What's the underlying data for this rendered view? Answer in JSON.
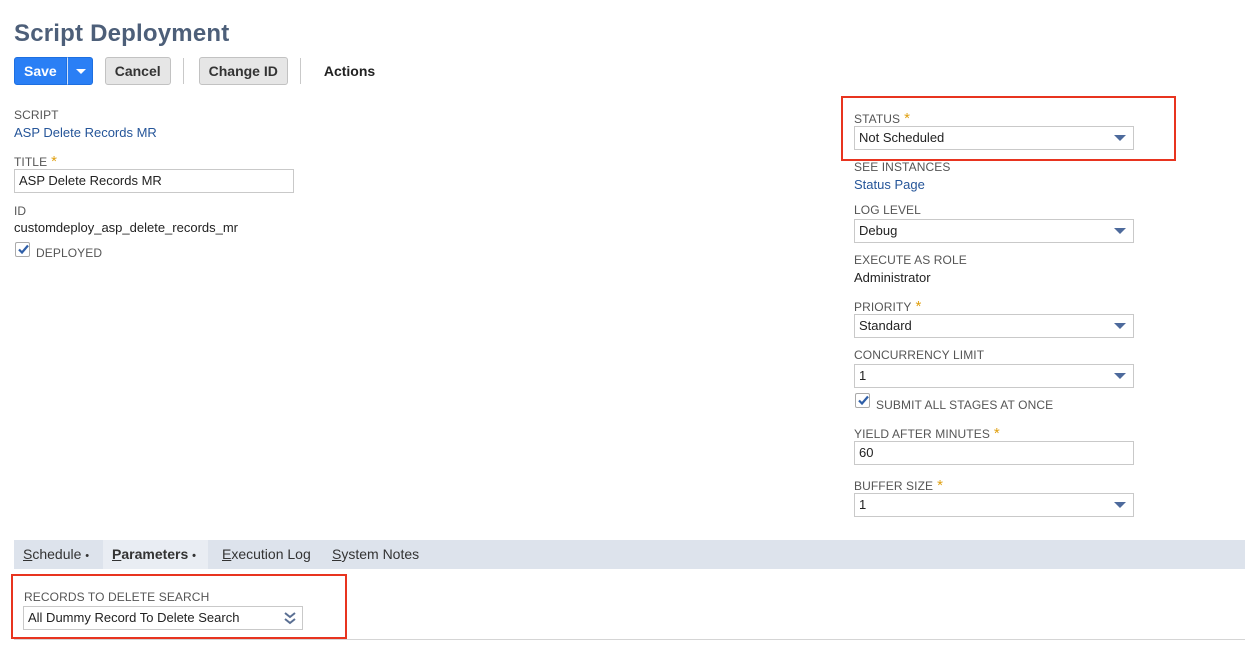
{
  "page": {
    "title": "Script Deployment"
  },
  "toolbar": {
    "save_label": "Save",
    "cancel_label": "Cancel",
    "change_id_label": "Change ID",
    "actions_label": "Actions"
  },
  "left": {
    "script_label": "SCRIPT",
    "script_value": "ASP Delete Records MR",
    "title_label": "TITLE",
    "title_value": "ASP Delete Records MR",
    "id_label": "ID",
    "id_value": "customdeploy_asp_delete_records_mr",
    "deployed_label": "DEPLOYED",
    "deployed_checked": true
  },
  "right": {
    "status_label": "STATUS",
    "status_value": "Not Scheduled",
    "see_instances_label": "SEE INSTANCES",
    "status_page_link": "Status Page",
    "log_level_label": "LOG LEVEL",
    "log_level_value": "Debug",
    "execute_as_role_label": "EXECUTE AS ROLE",
    "execute_as_role_value": "Administrator",
    "priority_label": "PRIORITY",
    "priority_value": "Standard",
    "concurrency_label": "CONCURRENCY LIMIT",
    "concurrency_value": "1",
    "submit_all_label": "SUBMIT ALL STAGES AT ONCE",
    "submit_all_checked": true,
    "yield_label": "YIELD AFTER MINUTES",
    "yield_value": "60",
    "buffer_label": "BUFFER SIZE",
    "buffer_value": "1"
  },
  "required_marker": "*",
  "tabs": [
    {
      "label": "Schedule",
      "first_letter": "S",
      "rest": "chedule",
      "dot": "•"
    },
    {
      "label": "Parameters",
      "first_letter": "P",
      "rest": "arameters",
      "dot": "•"
    },
    {
      "label": "Execution Log",
      "first_letter": "E",
      "rest": "xecution Log"
    },
    {
      "label": "System Notes",
      "first_letter": "S",
      "rest": "ystem Notes"
    }
  ],
  "parameters": {
    "records_search_label": "RECORDS TO DELETE SEARCH",
    "records_search_value": "All Dummy Record To Delete Search"
  },
  "colors": {
    "primary_button": "#2a7ff5",
    "highlight_border": "#e8341f",
    "link": "#255599",
    "required": "#e0a010",
    "title": "#4d5f79"
  }
}
